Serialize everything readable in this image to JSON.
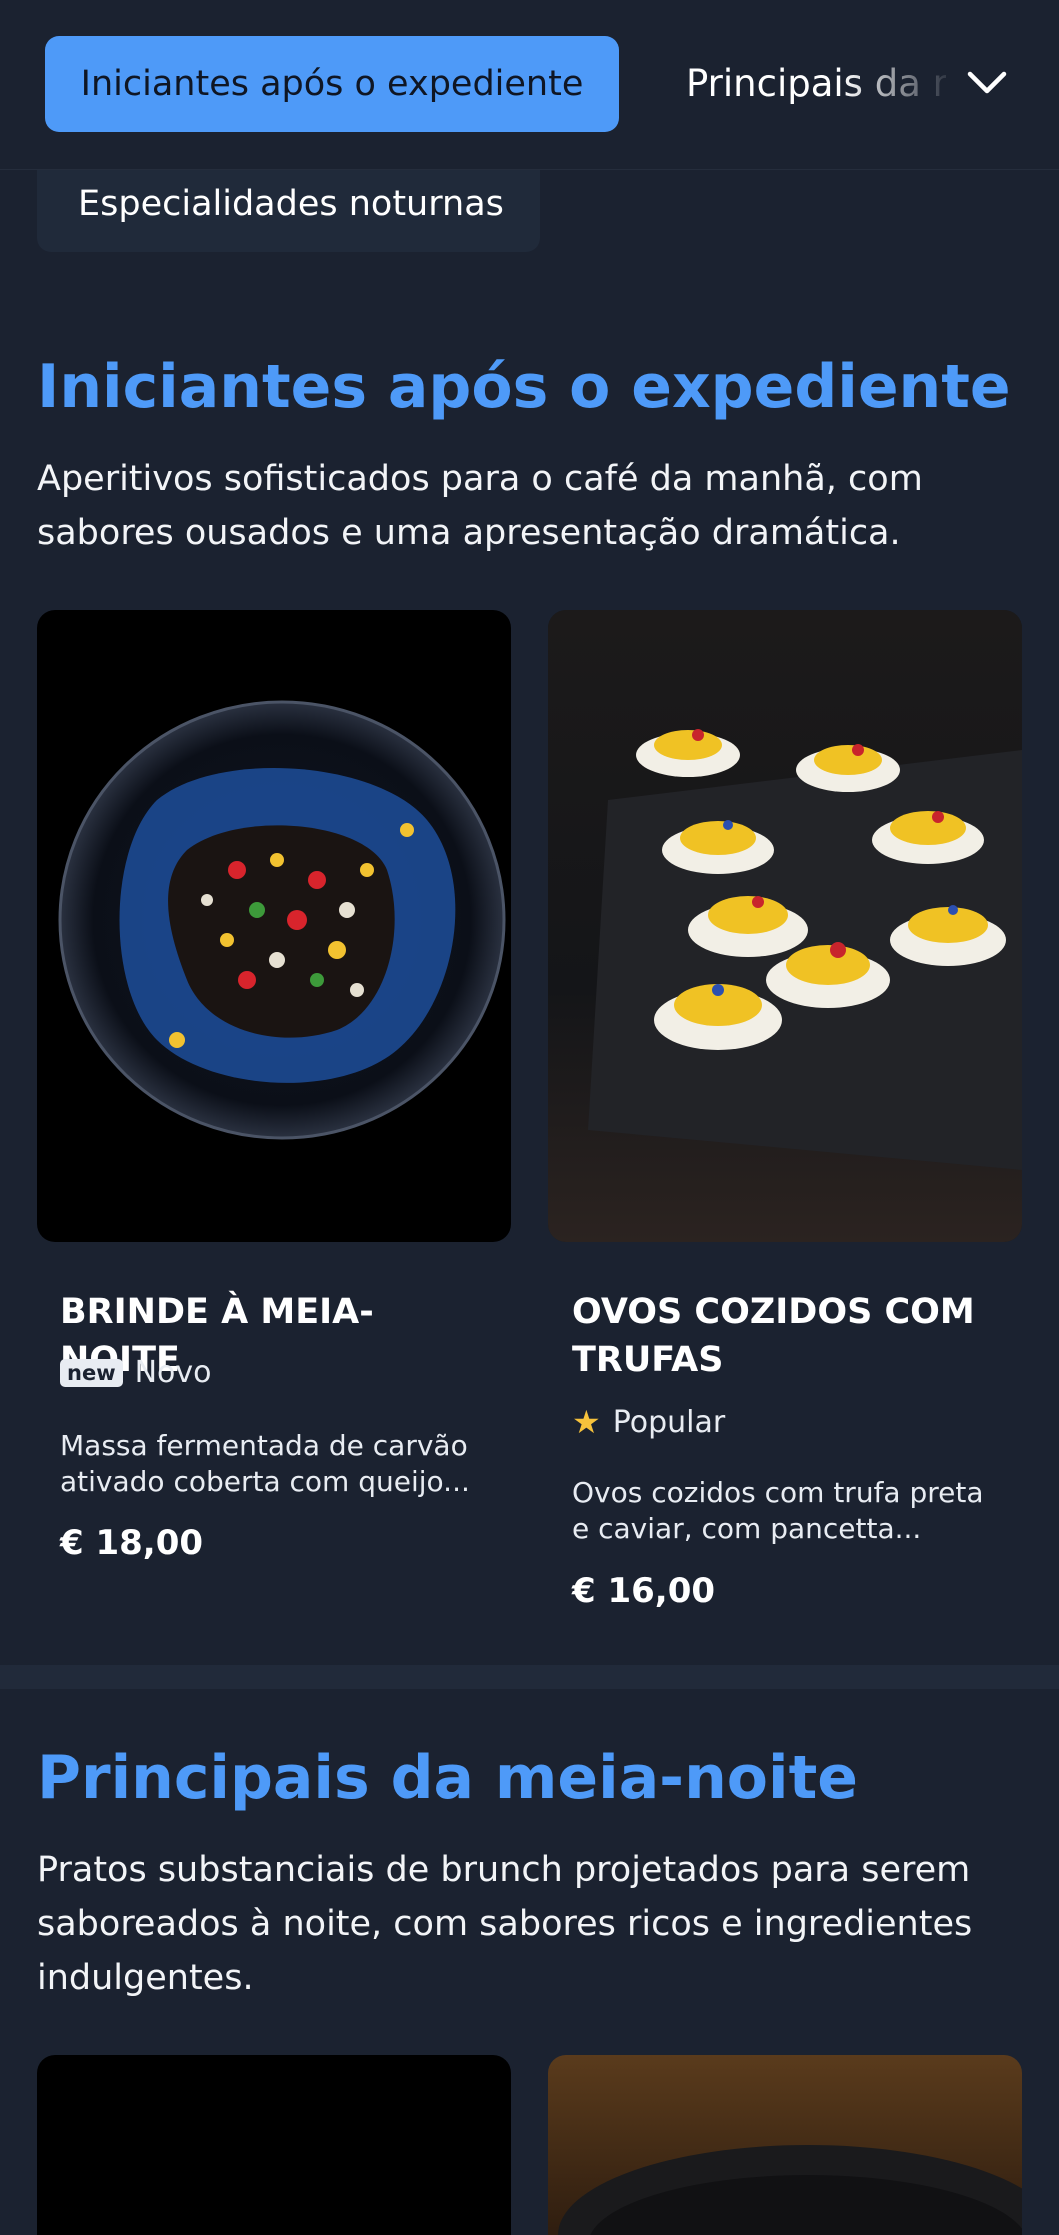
{
  "nav": {
    "tabs": [
      {
        "label": "Iniciantes após o expediente",
        "active": true
      },
      {
        "label": "Principais da meia-noite",
        "active": false
      },
      {
        "label": "Especialidades noturnas",
        "active": false
      }
    ],
    "expand_icon": "chevron-down-icon"
  },
  "sections": [
    {
      "title": "Iniciantes após o expediente",
      "description": "Aperitivos sofisticados para o café da manhã, com sabores ousados e uma apresentação dramática.",
      "items": [
        {
          "name": "BRINDE À MEIA-NOITE",
          "badge_icon": "new",
          "badge_label": "Novo",
          "description": "Massa fermentada de carvão ativado coberta com queijo...",
          "price": "€ 18,00"
        },
        {
          "name": "OVOS COZIDOS COM TRUFAS",
          "badge_icon": "star-icon",
          "badge_label": "Popular",
          "description": "Ovos cozidos com trufa preta e caviar, com pancetta...",
          "price": "€ 16,00"
        }
      ]
    },
    {
      "title": "Principais da meia-noite",
      "description": "Pratos substanciais de brunch projetados para serem saboreados à noite, com sabores ricos e ingredientes indulgentes."
    }
  ],
  "colors": {
    "background": "#1b2230",
    "accent": "#4e9af8",
    "star": "#f6c23c"
  }
}
